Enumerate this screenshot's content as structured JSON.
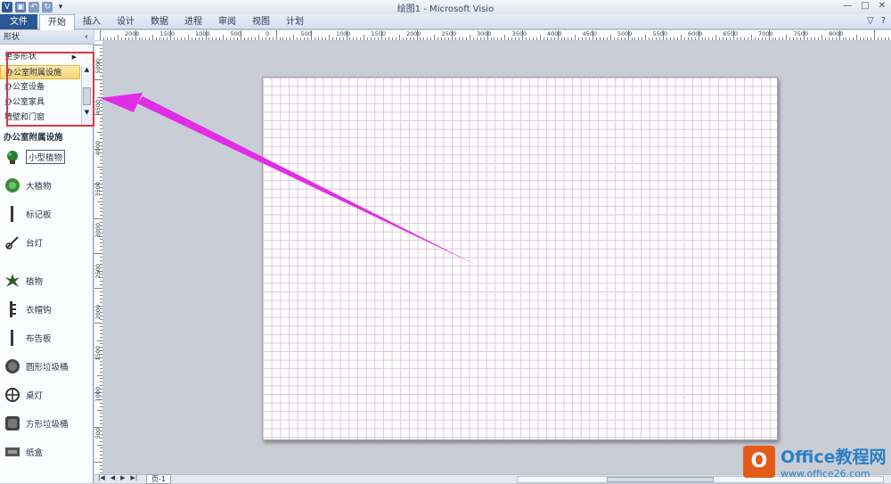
{
  "window": {
    "title": "绘图1 - Microsoft Visio",
    "controls": [
      "—",
      "□",
      "✕"
    ]
  },
  "ribbon": {
    "file_tab": "文件",
    "tabs": [
      "开始",
      "插入",
      "设计",
      "数据",
      "进程",
      "审阅",
      "视图",
      "计划"
    ],
    "active_tab": "开始"
  },
  "shapes_pane": {
    "header": "形状",
    "collapse_icon": "‹",
    "stencil_list": [
      "更多形状",
      "办公室附属设施",
      "办公室设备",
      "办公室家具",
      "墙壁和门窗"
    ],
    "selected_stencil": "办公室附属设施",
    "stencil_title": "办公室附属设施",
    "shapes": [
      {
        "label": "小型植物",
        "icon": "small-plant-icon"
      },
      {
        "label": "大植物",
        "icon": "large-plant-icon"
      },
      {
        "label": "标记板",
        "icon": "marker-board-icon"
      },
      {
        "label": "台灯",
        "icon": "desk-lamp-icon"
      },
      {
        "label": "植物",
        "icon": "plant-icon"
      },
      {
        "label": "衣帽钩",
        "icon": "coat-hook-icon"
      },
      {
        "label": "布告板",
        "icon": "bulletin-board-icon"
      },
      {
        "label": "圆形垃圾桶",
        "icon": "round-trash-icon"
      },
      {
        "label": "桌灯",
        "icon": "table-lamp-icon"
      },
      {
        "label": "方形垃圾桶",
        "icon": "square-trash-icon"
      },
      {
        "label": "纸盒",
        "icon": "paper-tray-icon"
      }
    ]
  },
  "rulers": {
    "horizontal": [
      "2000",
      "1500",
      "1000",
      "500",
      "0",
      "500",
      "1000",
      "1500",
      "2000",
      "2500",
      "3000",
      "3500",
      "4000",
      "4500",
      "5000",
      "5500",
      "6000",
      "6500",
      "7000",
      "7500",
      "8000"
    ],
    "vertical": [
      "5000",
      "4500",
      "4000",
      "3500",
      "3000",
      "2500",
      "2000",
      "1500",
      "1000",
      "500"
    ]
  },
  "status": {
    "page_tab": "页-1",
    "nav": [
      "|◀",
      "◀",
      "▶",
      "▶|"
    ]
  },
  "annotation": {
    "arrow_color": "#e12de6",
    "box_color": "#d33a44"
  },
  "watermark": {
    "logo_text": "O",
    "line1": "Office教程网",
    "line2": "www.office26.com"
  }
}
